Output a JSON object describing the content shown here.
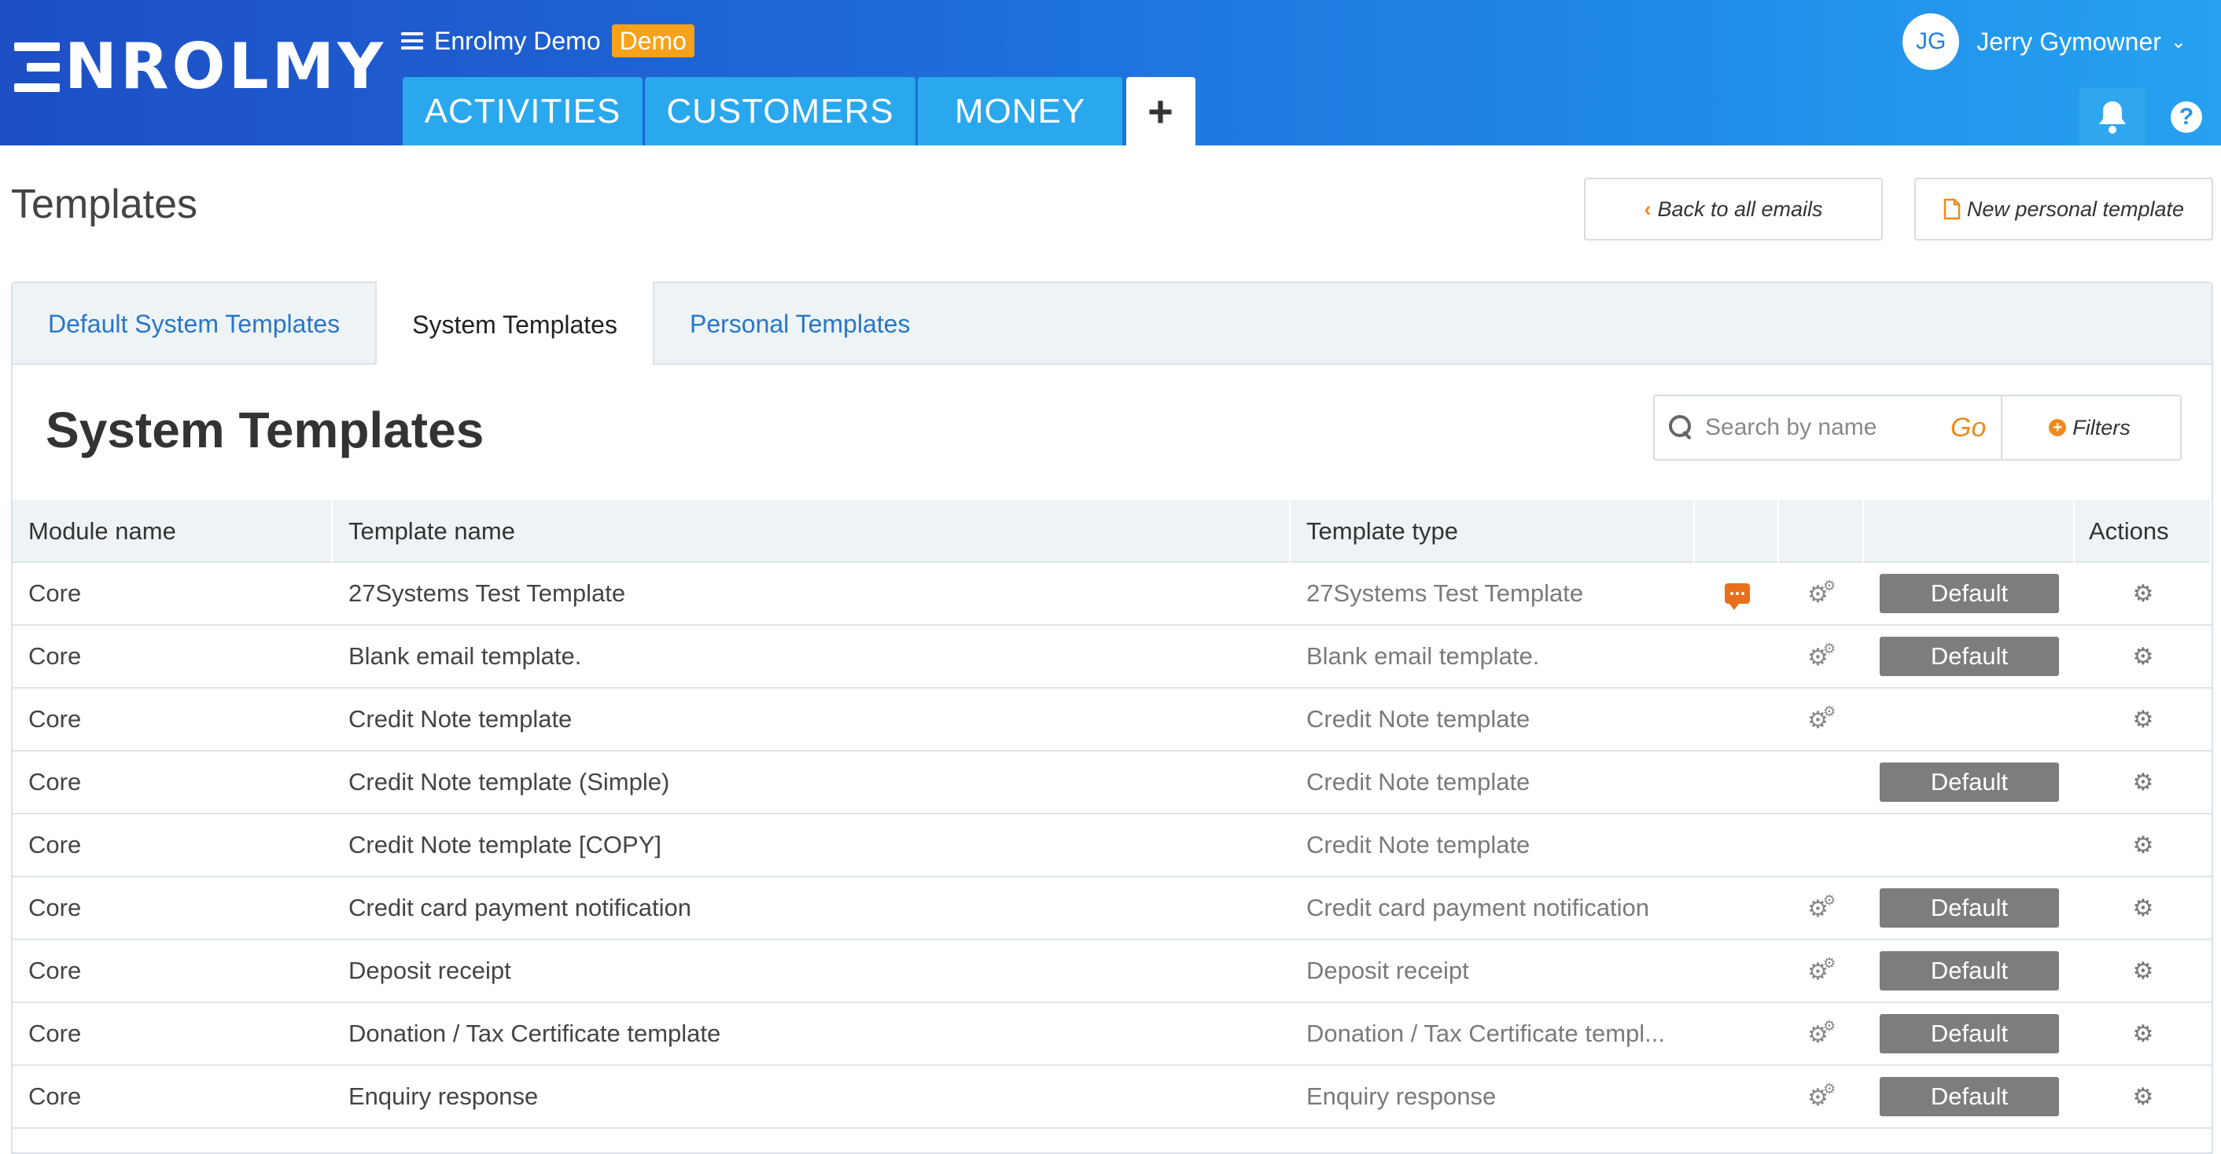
{
  "header": {
    "logo_text": "NROLMY",
    "org_name": "Enrolmy Demo",
    "demo_badge": "Demo",
    "nav": [
      "ACTIVITIES",
      "CUSTOMERS",
      "MONEY"
    ],
    "plus_label": "+",
    "user_initials": "JG",
    "user_name": "Jerry Gymowner",
    "help_label": "?"
  },
  "page": {
    "title": "Templates",
    "back_button": "Back to all emails",
    "new_template_button": "New personal template"
  },
  "tabs": [
    {
      "label": "Default System Templates",
      "active": false
    },
    {
      "label": "System Templates",
      "active": true
    },
    {
      "label": "Personal Templates",
      "active": false
    }
  ],
  "section": {
    "title": "System Templates",
    "search_placeholder": "Search by name",
    "go_label": "Go",
    "filters_label": "Filters"
  },
  "table": {
    "headers": [
      "Module name",
      "Template name",
      "Template type",
      "",
      "",
      "",
      "Actions"
    ],
    "default_label": "Default",
    "rows": [
      {
        "module": "Core",
        "name": "27Systems Test Template",
        "type": "27Systems Test Template",
        "chat": true,
        "gear": true,
        "default": true
      },
      {
        "module": "Core",
        "name": "Blank email template.",
        "type": "Blank email template.",
        "chat": false,
        "gear": true,
        "default": true
      },
      {
        "module": "Core",
        "name": "Credit Note template",
        "type": "Credit Note template",
        "chat": false,
        "gear": true,
        "default": false
      },
      {
        "module": "Core",
        "name": "Credit Note template (Simple)",
        "type": "Credit Note template",
        "chat": false,
        "gear": false,
        "default": true
      },
      {
        "module": "Core",
        "name": "Credit Note template [COPY]",
        "type": "Credit Note template",
        "chat": false,
        "gear": false,
        "default": false
      },
      {
        "module": "Core",
        "name": "Credit card payment notification",
        "type": "Credit card payment notification",
        "chat": false,
        "gear": true,
        "default": true
      },
      {
        "module": "Core",
        "name": "Deposit receipt",
        "type": "Deposit receipt",
        "chat": false,
        "gear": true,
        "default": true
      },
      {
        "module": "Core",
        "name": "Donation / Tax Certificate template",
        "type": "Donation / Tax Certificate templ...",
        "chat": false,
        "gear": true,
        "default": true
      },
      {
        "module": "Core",
        "name": "Enquiry response",
        "type": "Enquiry response",
        "chat": false,
        "gear": true,
        "default": true
      }
    ]
  },
  "colors": {
    "header_start": "#1e4fc4",
    "header_end": "#26a2f0",
    "nav_tab": "#2aa8ee",
    "demo_badge": "#f6a21a",
    "accent_orange": "#f08a1c",
    "tab_link": "#2a76c8",
    "default_button": "#7d7d7d"
  }
}
